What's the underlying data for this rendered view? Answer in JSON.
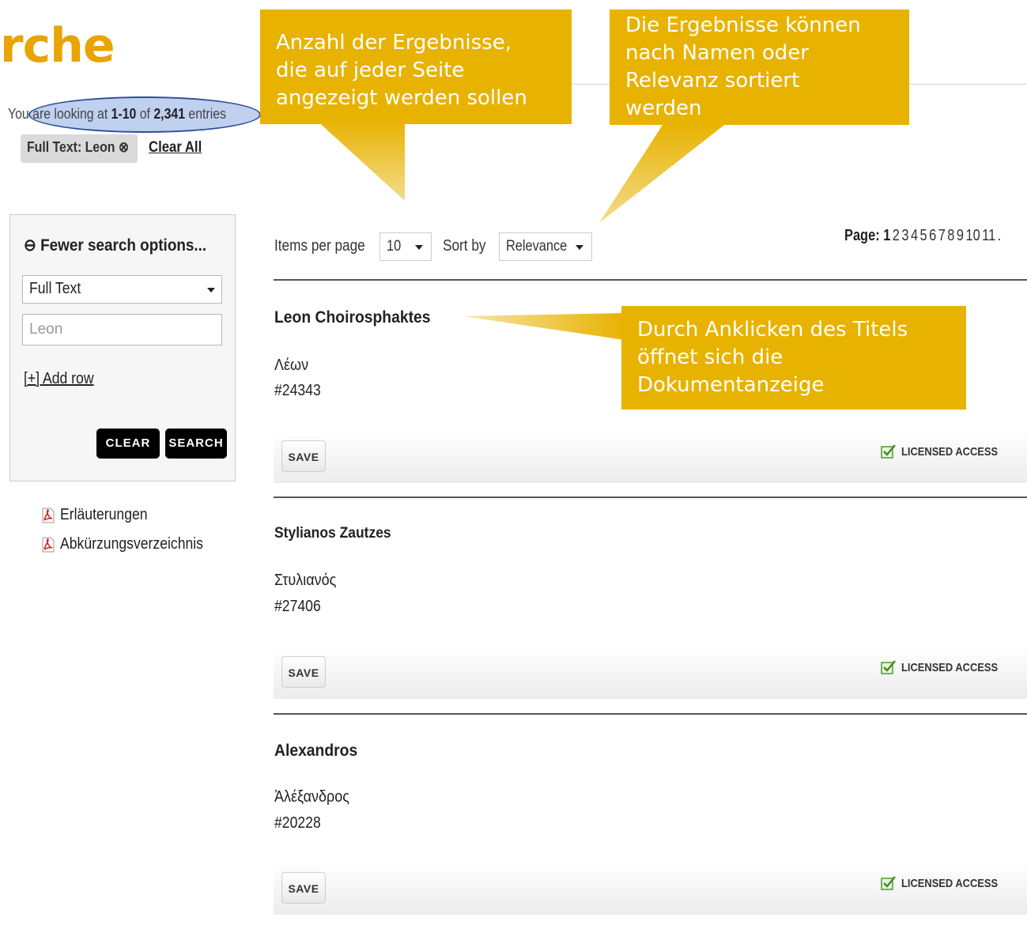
{
  "page": {
    "title_fragment": "rche"
  },
  "results_summary": {
    "prefix": "You are looking at ",
    "range": "1-10",
    "middle": " of ",
    "total": "2,341",
    "suffix": " entries"
  },
  "filters": {
    "chip_label": "Full Text: Leon",
    "chip_remove_glyph": "⊗",
    "clear_all": "Clear All"
  },
  "search_panel": {
    "toggle_glyph": "⊖",
    "toggle_label": "Fewer search options...",
    "field_select": "Full Text",
    "query_value": "Leon",
    "add_row": "[+] Add row",
    "clear_button": "CLEAR",
    "search_button": "SEARCH"
  },
  "documents": [
    {
      "label": "Erläuterungen",
      "icon": "pdf-icon"
    },
    {
      "label": "Abkürzungsverzeichnis",
      "icon": "pdf-icon"
    }
  ],
  "toolbar": {
    "items_per_page_label": "Items per page",
    "items_per_page_value": "10",
    "sort_by_label": "Sort by",
    "sort_by_value": "Relevance"
  },
  "pagination": {
    "label": "Page:",
    "current": "1",
    "pages": [
      "2",
      "3",
      "4",
      "5",
      "6",
      "7",
      "8",
      "9",
      "10",
      "11"
    ],
    "more": "."
  },
  "results": [
    {
      "title": "Leon Choirosphaktes",
      "greek_name": "Λέων",
      "id": "#24343",
      "save": "SAVE",
      "access": "LICENSED ACCESS"
    },
    {
      "title": "Stylianos Zautzes",
      "greek_name": "Στυλιανός",
      "id": "#27406",
      "save": "SAVE",
      "access": "LICENSED ACCESS"
    },
    {
      "title": "Alexandros",
      "greek_name": "Ἀλέξανδρος",
      "id": "#20228",
      "save": "SAVE",
      "access": "LICENSED ACCESS"
    }
  ],
  "callouts": {
    "items_per_page": [
      "Anzahl der Ergebnisse,",
      "die auf jeder Seite",
      "angezeigt werden sollen"
    ],
    "sorting": [
      "Die Ergebnisse können",
      "nach Namen oder",
      "Relevanz sortiert",
      "werden"
    ],
    "title_click": [
      "Durch Anklicken des Titels",
      "öffnet sich die",
      "Dokumentanzeige"
    ]
  },
  "colors": {
    "accent": "#e8a400",
    "callout": "#e8b200",
    "highlight_ellipse": "#2d4e9a",
    "button_dark": "#000000"
  }
}
